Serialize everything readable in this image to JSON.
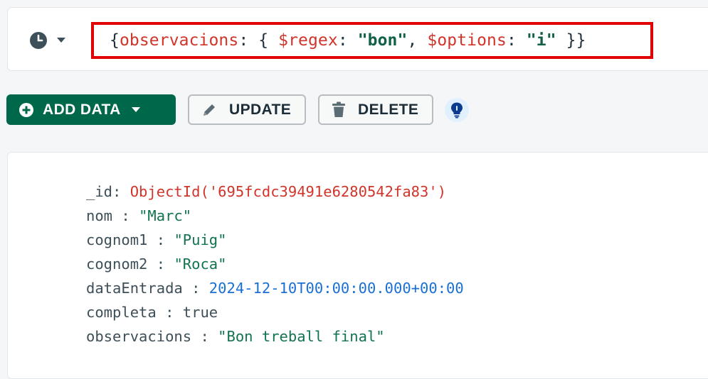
{
  "query": {
    "open": "{",
    "field": "observacions",
    "colon": ": { ",
    "op1": "$regex",
    "c1": ": ",
    "val1": "\"bon\"",
    "comma": ", ",
    "op2": "$options",
    "c2": ": ",
    "val2": "\"i\"",
    "close": " }}"
  },
  "toolbar": {
    "add_data_label": "ADD DATA",
    "update_label": "UPDATE",
    "delete_label": "DELETE"
  },
  "document": {
    "fields": [
      {
        "key": "_id",
        "sep": ": ",
        "value": "ObjectId('695fcdc39491e6280542fa83')",
        "type": "objectid"
      },
      {
        "key": "nom",
        "sep": " : ",
        "value": "\"Marc\"",
        "type": "string"
      },
      {
        "key": "cognom1",
        "sep": " : ",
        "value": "\"Puig\"",
        "type": "string"
      },
      {
        "key": "cognom2",
        "sep": " : ",
        "value": "\"Roca\"",
        "type": "string"
      },
      {
        "key": "dataEntrada",
        "sep": " : ",
        "value": "2024-12-10T00:00:00.000+00:00",
        "type": "date"
      },
      {
        "key": "completa",
        "sep": " : ",
        "value": "true",
        "type": "bool"
      },
      {
        "key": "observacions",
        "sep": " : ",
        "value": "\"Bon treball final\"",
        "type": "string"
      }
    ]
  },
  "colors": {
    "accent_green": "#00684a",
    "highlight_red": "#e00000",
    "key_red": "#d1342a",
    "string_green": "#11744f",
    "date_blue": "#1a6fd4"
  },
  "icons": [
    "clock-icon",
    "caret-down-icon",
    "plus-circle-icon",
    "pencil-icon",
    "trash-icon",
    "lightbulb-icon"
  ]
}
